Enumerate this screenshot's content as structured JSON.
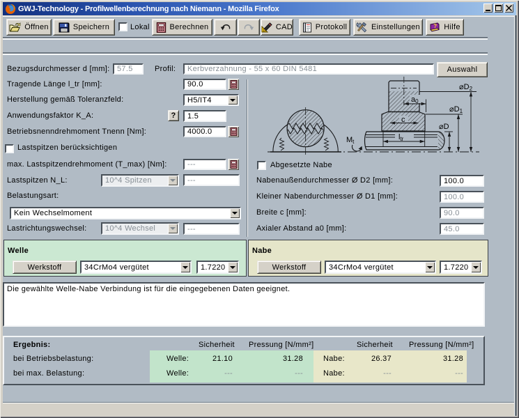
{
  "window": {
    "title": "GWJ-Technology - Profilwellenberechnung nach Niemann - Mozilla Firefox"
  },
  "toolbar": {
    "open": "Öffnen",
    "save": "Speichern",
    "local": "Lokal",
    "calculate": "Berechnen",
    "cad": "CAD",
    "protocol": "Protokoll",
    "settings": "Einstellungen",
    "help": "Hilfe"
  },
  "form": {
    "bezugsdurchmesser": {
      "label": "Bezugsdurchmesser d [mm]:",
      "value": "57.5"
    },
    "profil": {
      "label": "Profil:",
      "value": "Kerbverzahnung - 55 x 60 DIN 5481",
      "button": "Auswahl"
    },
    "tragende_laenge": {
      "label": "Tragende Länge l_tr [mm]:",
      "value": "90.0"
    },
    "toleranzfeld": {
      "label": "Herstellung gemäß Toleranzfeld:",
      "value": "H5/IT4"
    },
    "anwendungsfaktor": {
      "label": "Anwendungsfaktor K_A:",
      "help": "?",
      "value": "1.5"
    },
    "drehmoment": {
      "label": "Betriebsnenndrehmoment Tnenn [Nm]:",
      "value": "4000.0"
    },
    "lastspitzen_check": {
      "label": "Lastspitzen berücksichtigen"
    },
    "max_lastspitzen": {
      "label": "max. Lastspitzendrehmoment (T_max) [Nm]:",
      "value": "---"
    },
    "lastspitzen_nl": {
      "label": "Lastspitzen N_L:",
      "combo": "10^4 Spitzen",
      "value": "---"
    },
    "belastungsart": {
      "label": "Belastungsart:",
      "value": "Kein Wechselmoment"
    },
    "lastrichtungswechsel": {
      "label": "Lastrichtungswechsel:",
      "combo": "10^4 Wechsel",
      "value": "---"
    }
  },
  "nabe_form": {
    "abgesetzte_nabe": {
      "label": "Abgesetzte Nabe"
    },
    "d2": {
      "label": "Nabenaußendurchmesser Ø D2 [mm]:",
      "value": "100.0"
    },
    "d1": {
      "label": "Kleiner Nabendurchmesser Ø D1 [mm]:",
      "value": "100.0"
    },
    "breite": {
      "label": "Breite c [mm]:",
      "value": "90.0"
    },
    "abstand": {
      "label": "Axialer Abstand a0 [mm]:",
      "value": "45.0"
    }
  },
  "drawing": {
    "dim_d2_main": "⌀D",
    "dim_d2_sub": "2",
    "dim_d1_main": "⌀D",
    "dim_d1_sub": "1",
    "dim_d_main": "⌀D",
    "dim_a0_main": "a",
    "dim_a0_sub": "0",
    "dim_c": "c",
    "dim_ltr_main": "l",
    "dim_ltr_sub": "tr",
    "dim_mt_main": "M",
    "dim_mt_sub": "t"
  },
  "welle_panel": {
    "title": "Welle",
    "werkstoff": "Werkstoff",
    "material": "34CrMo4 vergütet",
    "number": "1.7220"
  },
  "nabe_panel": {
    "title": "Nabe",
    "werkstoff": "Werkstoff",
    "material": "34CrMo4 vergütet",
    "number": "1.7220"
  },
  "message": "Die gewählte Welle-Nabe Verbindung ist für die eingegebenen Daten geeignet.",
  "results": {
    "title": "Ergebnis:",
    "header_sicherheit": "Sicherheit",
    "header_pressung": "Pressung [N/mm²]",
    "rows": [
      {
        "label": "bei Betriebsbelastung:",
        "welle_label": "Welle:",
        "welle_sicherheit": "21.10",
        "welle_pressung": "31.28",
        "nabe_label": "Nabe:",
        "nabe_sicherheit": "26.37",
        "nabe_pressung": "31.28"
      },
      {
        "label": "bei max. Belastung:",
        "welle_label": "Welle:",
        "welle_sicherheit": "---",
        "welle_pressung": "---",
        "nabe_label": "Nabe:",
        "nabe_sicherheit": "---",
        "nabe_pressung": "---"
      }
    ]
  },
  "colors": {
    "titlebar_left": "#12307e",
    "titlebar_right": "#a6c8ea",
    "page_bg": "#b1bbc5",
    "chrome": "#d5d1c8",
    "welle_bg": "#cbe8d2",
    "nabe_bg": "#e5e5c9",
    "result_welle_bg": "#c2e4cb",
    "result_nabe_bg": "#e8e7c9",
    "disabled_text": "#868e95"
  }
}
